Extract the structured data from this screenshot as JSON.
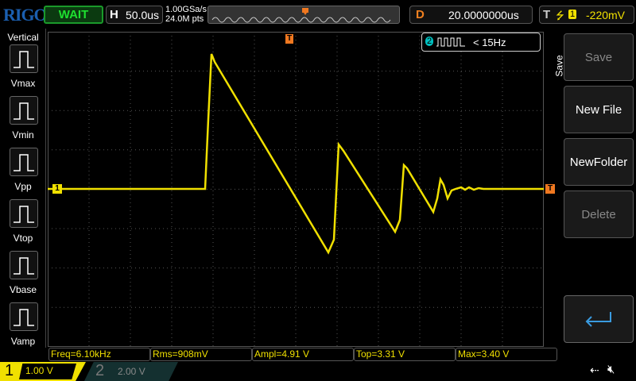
{
  "header": {
    "logo": "RIGOL",
    "status": "WAIT",
    "h_label": "H",
    "timebase": "50.0us",
    "sample_rate": "1.00GSa/s",
    "mem_depth": "24.0M pts",
    "d_label": "D",
    "delay": "20.0000000us",
    "t_label": "T",
    "trig_channel": "1",
    "trig_level": "-220mV"
  },
  "sidebar": {
    "title": "Vertical",
    "items": [
      {
        "label": "Vmax"
      },
      {
        "label": "Vmin"
      },
      {
        "label": "Vpp"
      },
      {
        "label": "Vtop"
      },
      {
        "label": "Vbase"
      },
      {
        "label": "Vamp"
      }
    ]
  },
  "freq_counter": {
    "channel": "2",
    "value": "< 15Hz"
  },
  "markers": {
    "ch1": "1",
    "trigger": "T"
  },
  "right_panel": {
    "title": "Save",
    "buttons": [
      {
        "label": "Save"
      },
      {
        "label": "New File"
      },
      {
        "label": "NewFolder"
      },
      {
        "label": "Delete"
      }
    ]
  },
  "measurements": [
    {
      "text": "Freq=6.10kHz"
    },
    {
      "text": "Rms=908mV"
    },
    {
      "text": "Ampl=4.91 V"
    },
    {
      "text": "Top=3.31 V"
    },
    {
      "text": "Max=3.40 V"
    }
  ],
  "channels": [
    {
      "num": "1",
      "scale": "1.00 V",
      "color": "#f0e000"
    },
    {
      "num": "2",
      "scale": "2.00 V",
      "color": "#00c0c0"
    }
  ]
}
